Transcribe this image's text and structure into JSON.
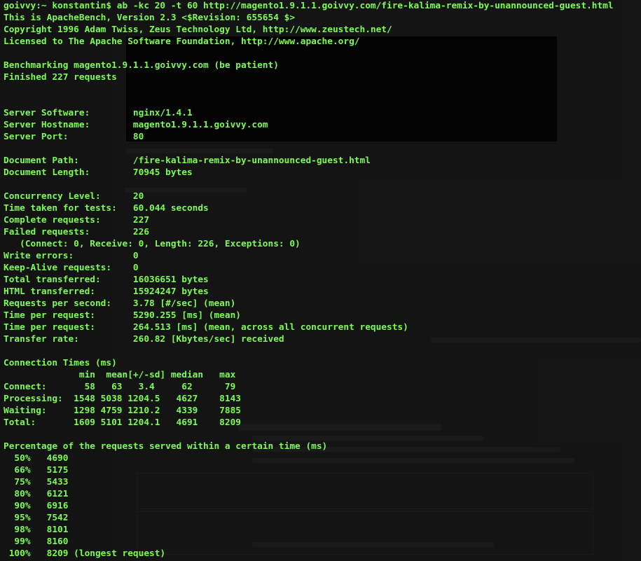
{
  "colors": {
    "terminal_text": "#7cfc52",
    "terminal_background": "#000000"
  },
  "terminal": {
    "lines": [
      "goivvy:~ konstantin$ ab -kc 20 -t 60 http://magento1.9.1.1.goivvy.com/fire-kalima-remix-by-unannounced-guest.html",
      "This is ApacheBench, Version 2.3 <$Revision: 655654 $>",
      "Copyright 1996 Adam Twiss, Zeus Technology Ltd, http://www.zeustech.net/",
      "Licensed to The Apache Software Foundation, http://www.apache.org/",
      "",
      "Benchmarking magento1.9.1.1.goivvy.com (be patient)",
      "Finished 227 requests",
      "",
      "",
      "Server Software:        nginx/1.4.1",
      "Server Hostname:        magento1.9.1.1.goivvy.com",
      "Server Port:            80",
      "",
      "Document Path:          /fire-kalima-remix-by-unannounced-guest.html",
      "Document Length:        70945 bytes",
      "",
      "Concurrency Level:      20",
      "Time taken for tests:   60.044 seconds",
      "Complete requests:      227",
      "Failed requests:        226",
      "   (Connect: 0, Receive: 0, Length: 226, Exceptions: 0)",
      "Write errors:           0",
      "Keep-Alive requests:    0",
      "Total transferred:      16036651 bytes",
      "HTML transferred:       15924247 bytes",
      "Requests per second:    3.78 [#/sec] (mean)",
      "Time per request:       5290.255 [ms] (mean)",
      "Time per request:       264.513 [ms] (mean, across all concurrent requests)",
      "Transfer rate:          260.82 [Kbytes/sec] received",
      "",
      "Connection Times (ms)",
      "              min  mean[+/-sd] median   max",
      "Connect:       58   63   3.4     62      79",
      "Processing:  1548 5038 1204.5   4627    8143",
      "Waiting:     1298 4759 1210.2   4339    7885",
      "Total:       1609 5101 1204.1   4691    8209",
      "",
      "Percentage of the requests served within a certain time (ms)",
      "  50%   4690",
      "  66%   5175",
      "  75%   5433",
      "  80%   6121",
      "  90%   6916",
      "  95%   7542",
      "  98%   8101",
      "  99%   8160",
      " 100%   8209 (longest request)"
    ]
  }
}
